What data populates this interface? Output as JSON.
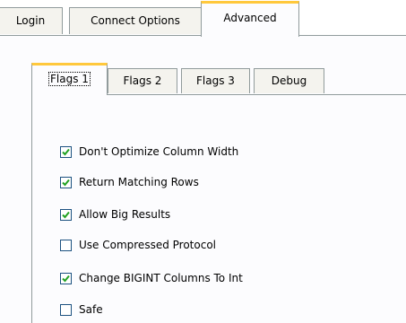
{
  "outer_tabs": [
    {
      "label": "Login"
    },
    {
      "label": "Connect Options"
    },
    {
      "label": "Advanced",
      "active": true
    }
  ],
  "inner_tabs": [
    {
      "label": "Flags 1",
      "active": true
    },
    {
      "label": "Flags 2"
    },
    {
      "label": "Flags 3"
    },
    {
      "label": "Debug"
    }
  ],
  "options": [
    {
      "label": "Don't Optimize Column Width",
      "checked": true
    },
    {
      "label": "Return Matching Rows",
      "checked": true
    },
    {
      "label": "Allow Big Results",
      "checked": true
    },
    {
      "label": "Use Compressed Protocol",
      "checked": false
    },
    {
      "label": "Change BIGINT Columns To Int",
      "checked": true
    },
    {
      "label": "Safe",
      "checked": false
    }
  ],
  "colors": {
    "active_tab_accent": "#ffc83c",
    "checkmark": "#21a121",
    "checkbox_border": "#1c5180"
  }
}
